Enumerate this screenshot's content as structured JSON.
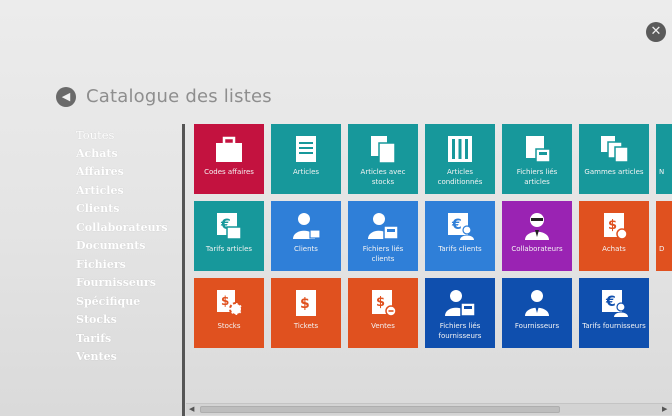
{
  "header": {
    "title": "Catalogue des listes"
  },
  "sidebar": {
    "items": [
      {
        "label": "Toutes"
      },
      {
        "label": "Achats"
      },
      {
        "label": "Affaires"
      },
      {
        "label": "Articles"
      },
      {
        "label": "Clients"
      },
      {
        "label": "Collaborateurs"
      },
      {
        "label": "Documents"
      },
      {
        "label": "Fichiers"
      },
      {
        "label": "Fournisseurs"
      },
      {
        "label": "Spécifique"
      },
      {
        "label": "Stocks"
      },
      {
        "label": "Tarifs"
      },
      {
        "label": "Ventes"
      }
    ]
  },
  "tiles": [
    {
      "label": "Codes affaires",
      "color": "#c3123f",
      "icon": "briefcase-icon"
    },
    {
      "label": "Articles",
      "color": "#17989b",
      "icon": "article-icon"
    },
    {
      "label": "Articles avec stocks",
      "color": "#17989b",
      "icon": "stacked-documents-icon"
    },
    {
      "label": "Articles conditionnés",
      "color": "#17989b",
      "icon": "crate-icon"
    },
    {
      "label": "Fichiers liés articles",
      "color": "#17989b",
      "icon": "file-linked-icon"
    },
    {
      "label": "Gammes articles",
      "color": "#17989b",
      "icon": "ranges-icon"
    },
    {
      "label": "N",
      "color": "#17989b",
      "icon": "partial-icon"
    },
    {
      "label": "Tarifs articles",
      "color": "#17989b",
      "icon": "price-tag-icon"
    },
    {
      "label": "Clients",
      "color": "#2f7fd8",
      "icon": "customer-icon"
    },
    {
      "label": "Fichiers liés clients",
      "color": "#2f7fd8",
      "icon": "customer-file-icon"
    },
    {
      "label": "Tarifs clients",
      "color": "#2f7fd8",
      "icon": "customer-price-icon"
    },
    {
      "label": "Collaborateurs",
      "color": "#9a23b3",
      "icon": "agent-icon"
    },
    {
      "label": "Achats",
      "color": "#e0511f",
      "icon": "purchase-icon"
    },
    {
      "label": "D",
      "color": "#e0511f",
      "icon": "partial-icon"
    },
    {
      "label": "Stocks",
      "color": "#e0511f",
      "icon": "stock-settings-icon"
    },
    {
      "label": "Tickets",
      "color": "#e0511f",
      "icon": "ticket-icon"
    },
    {
      "label": "Ventes",
      "color": "#e0511f",
      "icon": "sales-icon"
    },
    {
      "label": "Fichiers liés fournisseurs",
      "color": "#0f4fae",
      "icon": "supplier-file-icon"
    },
    {
      "label": "Fournisseurs",
      "color": "#0f4fae",
      "icon": "supplier-icon"
    },
    {
      "label": "Tarifs fournisseurs",
      "color": "#0f4fae",
      "icon": "supplier-price-icon"
    }
  ],
  "icons": {
    "close": "close-icon",
    "back": "back-arrow-icon"
  }
}
